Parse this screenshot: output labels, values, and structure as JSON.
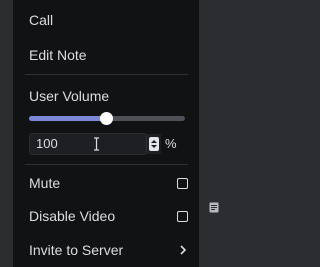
{
  "menu": {
    "call_label": "Call",
    "edit_note_label": "Edit Note",
    "user_volume_label": "User Volume",
    "volume": {
      "value": "100",
      "percent": 100,
      "max": 200,
      "unit": "%"
    },
    "mute_label": "Mute",
    "mute_checked": false,
    "disable_video_label": "Disable Video",
    "disable_video_checked": false,
    "invite_label": "Invite to Server"
  },
  "icons": {
    "note": "note-icon",
    "spinner": "number-spinner-icon",
    "chevron": "chevron-right-icon",
    "cursor": "text-cursor-icon"
  },
  "colors": {
    "menu_bg": "#111214",
    "accent": "#7d88d6",
    "text": "#dbdee1",
    "track": "#4e5058"
  }
}
